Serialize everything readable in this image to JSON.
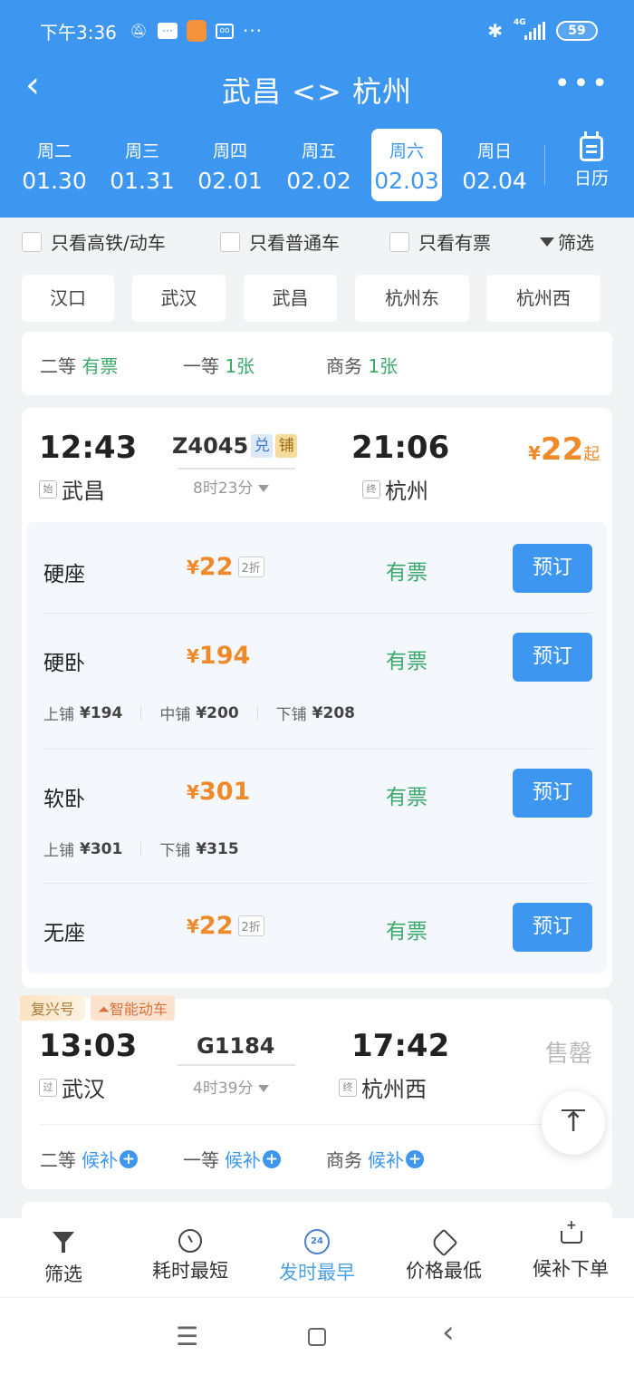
{
  "status_bar": {
    "time": "下午3:36",
    "left_icons": [
      "mute-icon",
      "message-icon",
      "shield-app-icon",
      "voicemail-icon",
      "more-dots"
    ],
    "network": "4G",
    "battery": "59"
  },
  "header": {
    "title": "武昌 <> 杭州",
    "back_icon": "‹",
    "more_icon": "•••"
  },
  "dates": [
    {
      "weekday": "周二",
      "date": "01.30",
      "active": false
    },
    {
      "weekday": "周三",
      "date": "01.31",
      "active": false
    },
    {
      "weekday": "周四",
      "date": "02.01",
      "active": false
    },
    {
      "weekday": "周五",
      "date": "02.02",
      "active": false
    },
    {
      "weekday": "周六",
      "date": "02.03",
      "active": true
    },
    {
      "weekday": "周日",
      "date": "02.04",
      "active": false
    }
  ],
  "calendar_label": "日历",
  "filters": {
    "checkboxes": [
      {
        "label": "只看高铁/动车",
        "checked": false
      },
      {
        "label": "只看普通车",
        "checked": false
      },
      {
        "label": "只看有票",
        "checked": false
      }
    ],
    "filter_label": "筛选"
  },
  "stations": [
    "汉口",
    "武汉",
    "武昌",
    "杭州东",
    "杭州西"
  ],
  "summary_card": {
    "seats": [
      {
        "class": "二等",
        "status": "有票"
      },
      {
        "class": "一等",
        "status": "1张"
      },
      {
        "class": "商务",
        "status": "1张"
      }
    ]
  },
  "trains": [
    {
      "depart_time": "12:43",
      "depart_tag": "始",
      "depart_station": "武昌",
      "train_no": "Z4045",
      "badges": [
        "兑",
        "铺"
      ],
      "duration": "8时23分",
      "arrive_time": "21:06",
      "arrive_tag": "终",
      "arrive_station": "杭州",
      "price_currency": "¥",
      "price_from": "22",
      "price_suffix": "起",
      "seats": [
        {
          "name": "硬座",
          "currency": "¥",
          "price": "22",
          "discount": "2折",
          "status": "有票",
          "button": "预订",
          "berths": []
        },
        {
          "name": "硬卧",
          "currency": "¥",
          "price": "194",
          "discount": "",
          "status": "有票",
          "button": "预订",
          "berths": [
            {
              "label": "上铺",
              "price": "¥194"
            },
            {
              "label": "中铺",
              "price": "¥200"
            },
            {
              "label": "下铺",
              "price": "¥208"
            }
          ]
        },
        {
          "name": "软卧",
          "currency": "¥",
          "price": "301",
          "discount": "",
          "status": "有票",
          "button": "预订",
          "berths": [
            {
              "label": "上铺",
              "price": "¥301"
            },
            {
              "label": "下铺",
              "price": "¥315"
            }
          ]
        },
        {
          "name": "无座",
          "currency": "¥",
          "price": "22",
          "discount": "2折",
          "status": "有票",
          "button": "预订",
          "berths": []
        }
      ]
    },
    {
      "tags": [
        "复兴号",
        "智能动车"
      ],
      "depart_time": "13:03",
      "depart_tag": "过",
      "depart_station": "武汉",
      "train_no": "G1184",
      "duration": "4时39分",
      "arrive_time": "17:42",
      "arrive_tag": "终",
      "arrive_station": "杭州西",
      "status": "售罄",
      "waitlist": [
        {
          "class": "二等",
          "action": "候补"
        },
        {
          "class": "一等",
          "action": "候补"
        },
        {
          "class": "商务",
          "action": "候补"
        }
      ]
    }
  ],
  "sort_bar": [
    {
      "label": "筛选",
      "icon": "filter-icon",
      "active": false
    },
    {
      "label": "耗时最短",
      "icon": "clock-icon",
      "active": false
    },
    {
      "label": "发时最早",
      "icon": "24h-icon",
      "icon_text": "24",
      "active": true
    },
    {
      "label": "价格最低",
      "icon": "price-tag-icon",
      "active": false
    },
    {
      "label": "候补下单",
      "icon": "cart-icon",
      "active": false
    }
  ],
  "system_nav": {
    "menu": "☰",
    "back": "‹"
  },
  "colors": {
    "primary": "#3d97f0",
    "price": "#ef8a2a",
    "available": "#3ba86c",
    "sold_out": "#bbbbbb"
  }
}
